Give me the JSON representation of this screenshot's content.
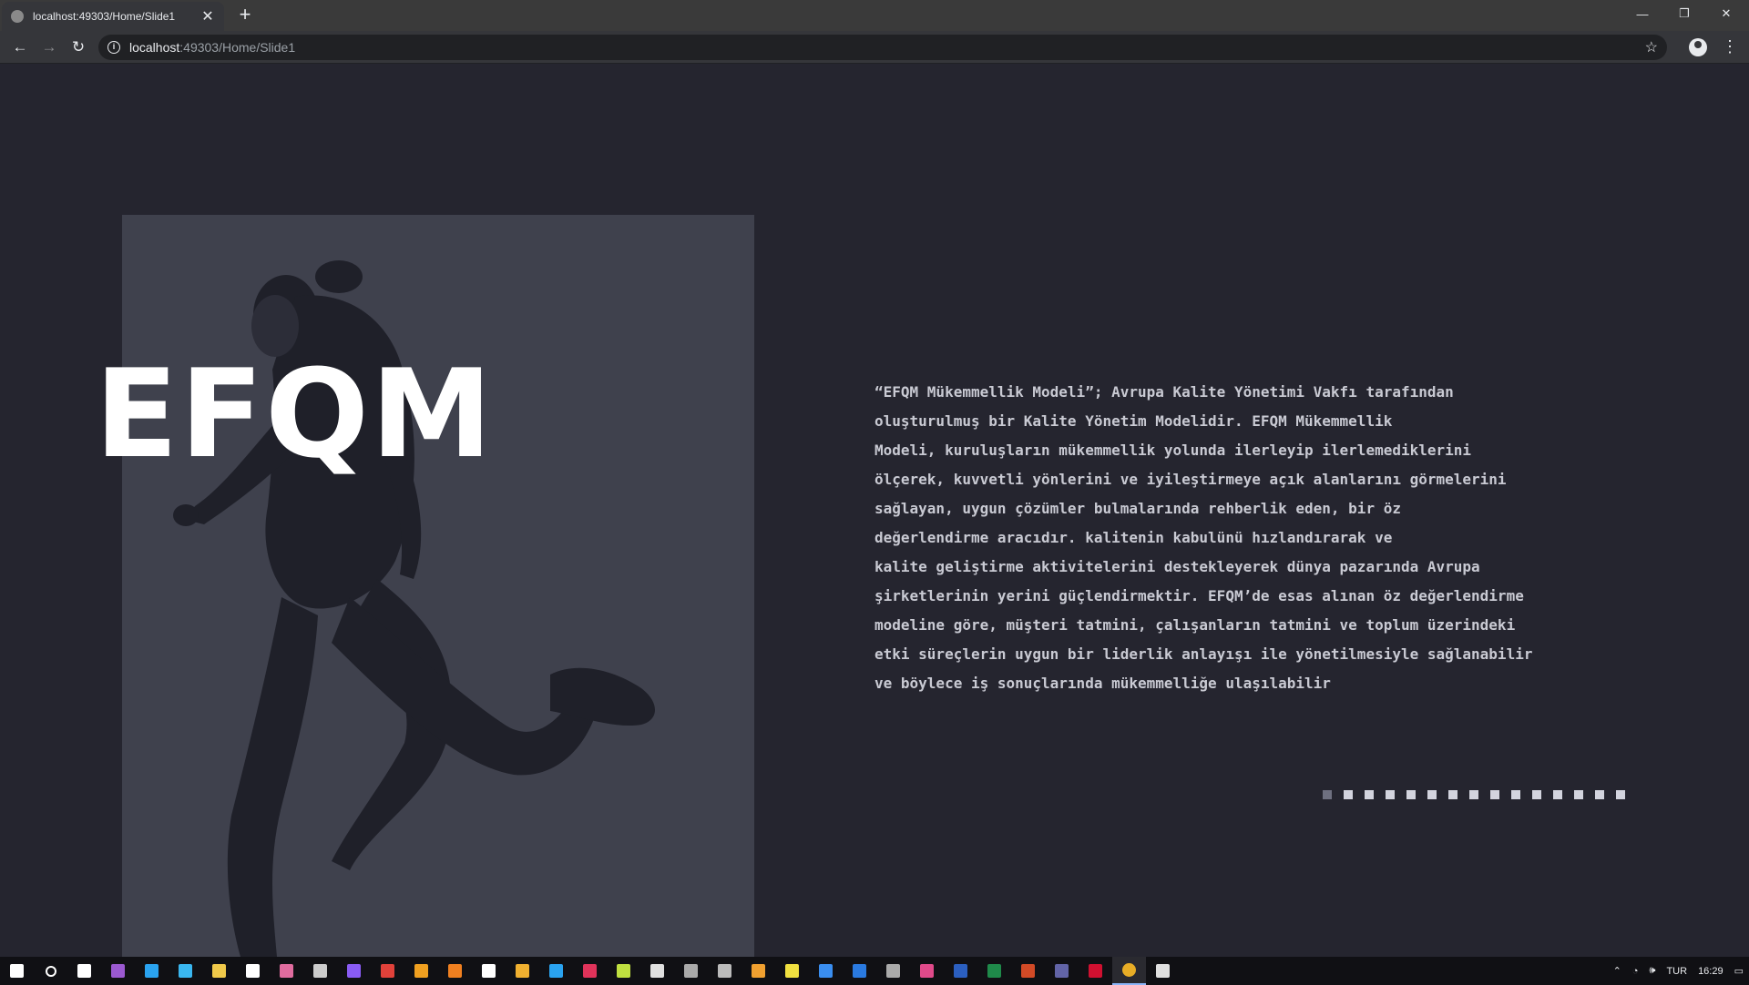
{
  "browser": {
    "tab_title": "localhost:49303/Home/Slide1",
    "tab_close": "✕",
    "new_tab": "+",
    "url_host": "localhost",
    "url_path": ":49303/Home/Slide1",
    "back": "←",
    "forward": "→",
    "reload": "↻",
    "star": "☆",
    "menu": "⋮",
    "minimize": "—",
    "restore": "❐",
    "close": "✕"
  },
  "slide": {
    "headline": "EFQM",
    "description_lines": [
      "“EFQM Mükemmellik Modeli”; Avrupa Kalite Yönetimi Vakfı tarafından",
      "oluşturulmuş bir Kalite Yönetim Modelidir. EFQM Mükemmellik",
      "Modeli, kuruluşların mükemmellik yolunda ilerleyip ilerlemediklerini",
      "ölçerek, kuvvetli yönlerini ve iyileştirmeye açık alanlarını görmelerini",
      "sağlayan,  uygun çözümler bulmalarında rehberlik eden, bir öz",
      "değerlendirme aracıdır. kalitenin kabulünü hızlandırarak ve",
      "kalite geliştirme aktivitelerini destekleyerek dünya pazarında Avrupa",
      "şirketlerinin yerini güçlendirmektir. EFQM’de esas alınan öz değerlendirme",
      "modeline göre, müşteri tatmini, çalışanların tatmini ve toplum üzerindeki",
      "etki süreçlerin uygun bir liderlik anlayışı ile yönetilmesiyle sağlanabilir",
      "ve böylece iş sonuçlarında mükemmelliğe ulaşılabilir"
    ],
    "slide_count": 15,
    "active_slide": 1,
    "colors": {
      "background": "#25252f",
      "photo_background": "#3f414d",
      "headline": "#ffffff",
      "text": "#c9cad3",
      "dot": "#d3d4de",
      "dot_active": "#6e7080"
    }
  },
  "taskbar": {
    "icons": [
      {
        "name": "start-icon",
        "color": "#ffffff"
      },
      {
        "name": "search-icon",
        "color": "#ffffff"
      },
      {
        "name": "task-view-icon",
        "color": "#ffffff"
      },
      {
        "name": "visual-studio-icon",
        "color": "#9b59d0"
      },
      {
        "name": "vscode-icon",
        "color": "#2aa3f0"
      },
      {
        "name": "app-icon",
        "color": "#3ab7f0"
      },
      {
        "name": "app-icon",
        "color": "#f0c94a"
      },
      {
        "name": "app-icon",
        "color": "#ffffff"
      },
      {
        "name": "paint-icon",
        "color": "#e06c9f"
      },
      {
        "name": "app-icon",
        "color": "#cccccc"
      },
      {
        "name": "app-icon",
        "color": "#8a5cf5"
      },
      {
        "name": "acrobat-icon",
        "color": "#e0413a"
      },
      {
        "name": "app-icon",
        "color": "#f0a020"
      },
      {
        "name": "blender-icon",
        "color": "#f08020"
      },
      {
        "name": "app-icon",
        "color": "#ffffff"
      },
      {
        "name": "app-icon",
        "color": "#f0b030"
      },
      {
        "name": "skype-icon",
        "color": "#2aa3f0"
      },
      {
        "name": "app-icon",
        "color": "#e0335a"
      },
      {
        "name": "app-icon",
        "color": "#c0e040"
      },
      {
        "name": "app-icon",
        "color": "#e0e0e0"
      },
      {
        "name": "app-icon",
        "color": "#aaaaaa"
      },
      {
        "name": "app-icon",
        "color": "#bbbbbb"
      },
      {
        "name": "app-icon",
        "color": "#f0a030"
      },
      {
        "name": "app-icon",
        "color": "#f0e040"
      },
      {
        "name": "app-icon",
        "color": "#3a8ef0"
      },
      {
        "name": "app-icon",
        "color": "#2a7ae0"
      },
      {
        "name": "app-icon",
        "color": "#aaaaaa"
      },
      {
        "name": "app-icon",
        "color": "#e04a8a"
      },
      {
        "name": "word-icon",
        "color": "#2b5fc0"
      },
      {
        "name": "excel-icon",
        "color": "#1f8a4a"
      },
      {
        "name": "powerpoint-icon",
        "color": "#d24a26"
      },
      {
        "name": "teams-icon",
        "color": "#6264a7"
      },
      {
        "name": "app-icon",
        "color": "#d01030"
      },
      {
        "name": "chrome-icon",
        "color": "#e8ad26"
      },
      {
        "name": "app-icon",
        "color": "#e0e0e0"
      }
    ],
    "tray_language": "TUR",
    "tray_time": "16:29",
    "tray_chevron": "⌃",
    "tray_wifi": "◔",
    "tray_volume": "🕪",
    "tray_notification": "▭"
  }
}
